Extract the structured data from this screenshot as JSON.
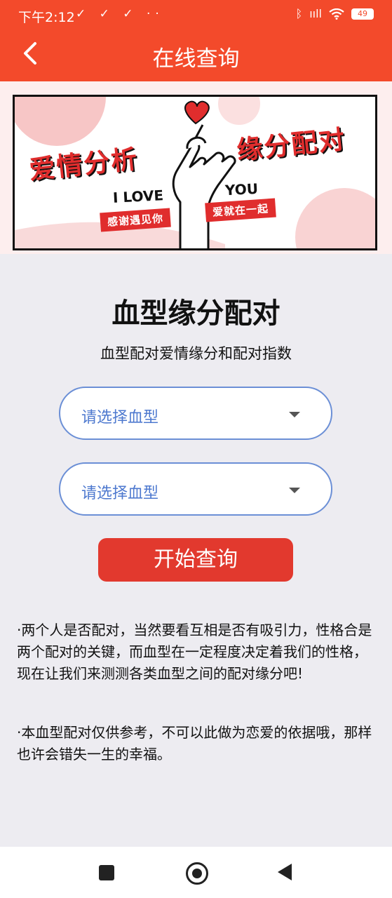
{
  "status_bar": {
    "time": "下午2:12",
    "left_icons": "✓ ✓ ✓ ··",
    "signal": "ııll",
    "battery": "49",
    "icons": [
      "mute-icon",
      "check-icon",
      "bluetooth-icon",
      "signal-icon",
      "wifi-icon",
      "battery-icon"
    ]
  },
  "app_bar": {
    "title": "在线查询",
    "back_icon": "chevron-left-icon"
  },
  "banner": {
    "title_left": "爱情分析",
    "title_right": "缘分配对",
    "love_text": "I LOVE",
    "you_text": "YOU",
    "tag_left": "感谢遇见你",
    "tag_right": "爱就在一起"
  },
  "main": {
    "title": "血型缘分配对",
    "subtitle": "血型配对爱情缘分和配对指数",
    "select_1": "请选择血型",
    "select_2": "请选择血型",
    "query_button": "开始查询"
  },
  "notes": [
    "·两个人是否配对，当然要看互相是否有吸引力，性格合是两个配对的关键，而血型在一定程度决定着我们的性格，现在让我们来测测各类血型之间的配对缘分吧!",
    "·本血型配对仅供参考，不可以此做为恋爱的依据哦，那样也许会错失一生的幸福。"
  ],
  "nav": {
    "icons": [
      "recents-square-icon",
      "home-circle-icon",
      "back-triangle-icon"
    ]
  },
  "colors": {
    "header": "#f34a2b",
    "button": "#e2392e",
    "select_border": "#6b8fd6",
    "select_text": "#4e79cf",
    "background": "#edecf1"
  }
}
